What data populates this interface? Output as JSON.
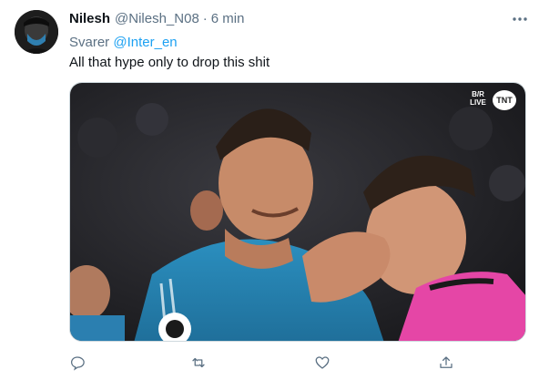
{
  "tweet": {
    "author_name": "Nilesh",
    "author_handle": "@Nilesh_N08",
    "separator": "·",
    "time": "6 min",
    "reply_prefix": "Svarer",
    "reply_to": "@Inter_en",
    "text": "All that hype only to drop this shit"
  },
  "media": {
    "overlay_logo": "B/R LIVE",
    "overlay_network": "TNT"
  },
  "icons": {
    "more": "more-dots-icon",
    "reply": "reply-icon",
    "retweet": "retweet-icon",
    "like": "like-icon",
    "share": "share-icon"
  },
  "colors": {
    "accent": "#1da1f2",
    "secondary_text": "#5b7083",
    "primary_text": "#0f1419"
  }
}
